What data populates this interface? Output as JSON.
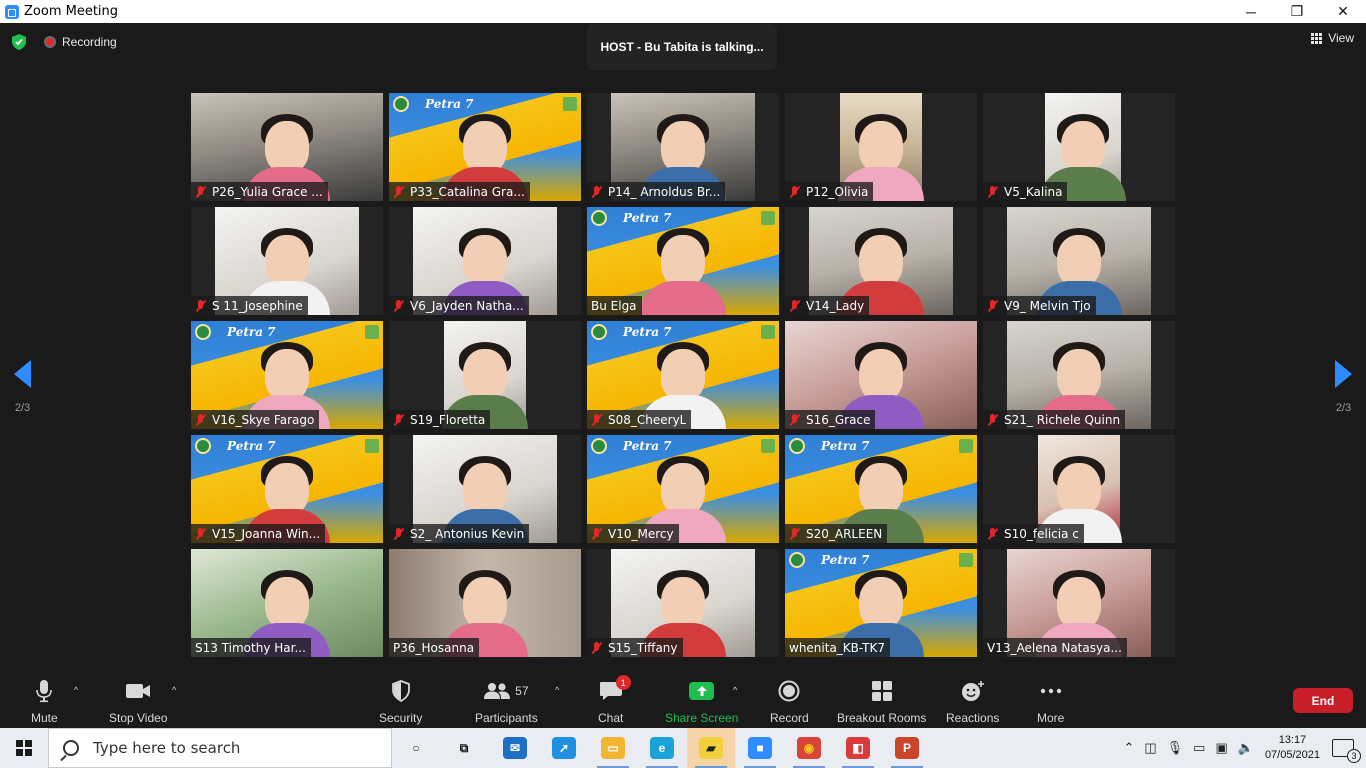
{
  "window": {
    "title": "Zoom Meeting",
    "minimize_label": "─",
    "maximize_label": "❐",
    "close_label": "✕"
  },
  "meeting": {
    "recording_label": "Recording",
    "talking_banner": "HOST - Bu Tabita is talking...",
    "view_label": "View",
    "page_left": "2/3",
    "page_right": "2/3"
  },
  "participants_grid": [
    {
      "name": "P26_Yulia Grace ...",
      "muted": true,
      "bg": "room",
      "layout": "full"
    },
    {
      "name": "P33_Catalina Gra...",
      "muted": true,
      "bg": "petra",
      "layout": "full"
    },
    {
      "name": "P14_ Arnoldus Br...",
      "muted": true,
      "bg": "room",
      "layout": "cam-wide"
    },
    {
      "name": "P12_Olivia",
      "muted": true,
      "bg": "shelf",
      "layout": "cam-narrow"
    },
    {
      "name": "V5_Kalina",
      "muted": true,
      "bg": "white",
      "layout": "cam-x-narrow"
    },
    {
      "name": "S 11_Josephine",
      "muted": true,
      "bg": "white",
      "layout": "cam-wide"
    },
    {
      "name": "V6_Jayden Natha...",
      "muted": true,
      "bg": "white",
      "layout": "cam-wide"
    },
    {
      "name": "Bu Elga",
      "muted": false,
      "bg": "petra",
      "layout": "full"
    },
    {
      "name": "V14_Lady",
      "muted": true,
      "bg": "wall",
      "layout": "cam-wide"
    },
    {
      "name": "V9_ Melvin Tjo",
      "muted": true,
      "bg": "wall",
      "layout": "cam-wide"
    },
    {
      "name": "V16_Skye Farago",
      "muted": true,
      "bg": "petra",
      "layout": "full"
    },
    {
      "name": "S19_Floretta",
      "muted": true,
      "bg": "white",
      "layout": "cam-narrow"
    },
    {
      "name": "S08_CheeryL",
      "muted": true,
      "bg": "petra",
      "layout": "full"
    },
    {
      "name": "S16_Grace",
      "muted": true,
      "bg": "pink",
      "layout": "full"
    },
    {
      "name": "S21_ Richele Quinn",
      "muted": true,
      "bg": "wall",
      "layout": "cam-wide"
    },
    {
      "name": "V15_Joanna Win...",
      "muted": true,
      "bg": "petra",
      "layout": "full"
    },
    {
      "name": "S2_ Antonius Kevin",
      "muted": true,
      "bg": "white",
      "layout": "cam-wide"
    },
    {
      "name": "V10_Mercy",
      "muted": true,
      "bg": "petra",
      "layout": "full"
    },
    {
      "name": "S20_ARLEEN",
      "muted": true,
      "bg": "petra",
      "layout": "full"
    },
    {
      "name": "S10_felicia c",
      "muted": true,
      "bg": "red",
      "layout": "cam-narrow"
    },
    {
      "name": "S13 Timothy Har...",
      "muted": false,
      "bg": "green",
      "layout": "full"
    },
    {
      "name": "P36_Hosanna",
      "muted": false,
      "bg": "curtain",
      "layout": "full"
    },
    {
      "name": "S15_Tiffany",
      "muted": true,
      "bg": "white",
      "layout": "cam-wide"
    },
    {
      "name": "whenita_KB-TK7",
      "muted": false,
      "bg": "petra",
      "layout": "full"
    },
    {
      "name": "V13_Aelena Natasya...",
      "muted": false,
      "bg": "pink",
      "layout": "cam-wide"
    }
  ],
  "petra_banner_text": "Petra 7",
  "toolbar": {
    "mute_label": "Mute",
    "stop_video_label": "Stop Video",
    "security_label": "Security",
    "participants_label": "Participants",
    "participants_count": "57",
    "chat_label": "Chat",
    "chat_badge": "1",
    "share_screen_label": "Share Screen",
    "record_label": "Record",
    "breakout_label": "Breakout Rooms",
    "reactions_label": "Reactions",
    "more_label": "More",
    "end_label": "End",
    "caret": "^"
  },
  "taskbar": {
    "search_placeholder": "Type here to search",
    "time": "13:17",
    "date": "07/05/2021",
    "notification_count": "3",
    "apps": [
      {
        "name": "cortana-icon",
        "glyph": "○",
        "color": "transparent",
        "text_color": "#111"
      },
      {
        "name": "task-view-icon",
        "glyph": "⧉",
        "color": "transparent",
        "text_color": "#111"
      },
      {
        "name": "mail-icon",
        "glyph": "✉",
        "color": "#1f6fc5",
        "text_color": "#fff"
      },
      {
        "name": "edge-legacy-icon",
        "glyph": "➚",
        "color": "#1f8fe0",
        "text_color": "#fff"
      },
      {
        "name": "file-explorer-icon",
        "glyph": "▭",
        "color": "#f2b632",
        "text_color": "#fff"
      },
      {
        "name": "edge-icon",
        "glyph": "e",
        "color": "#1aa3d6",
        "text_color": "#fff"
      },
      {
        "name": "sticky-notes-icon",
        "glyph": "▰",
        "color": "#f2d13a",
        "text_color": "#222"
      },
      {
        "name": "zoom-icon",
        "glyph": "■",
        "color": "#2d8cff",
        "text_color": "#fff"
      },
      {
        "name": "chrome-icon",
        "glyph": "◉",
        "color": "#d9443a",
        "text_color": "#f5c518"
      },
      {
        "name": "photos-icon",
        "glyph": "◧",
        "color": "#d83b3b",
        "text_color": "#fff"
      },
      {
        "name": "powerpoint-icon",
        "glyph": "P",
        "color": "#c9462b",
        "text_color": "#fff"
      }
    ]
  },
  "colors": {
    "accent": "#2d8cff",
    "share_green": "#1fbf4f",
    "end_red": "#c81e2a",
    "muted_red": "#e02828"
  }
}
